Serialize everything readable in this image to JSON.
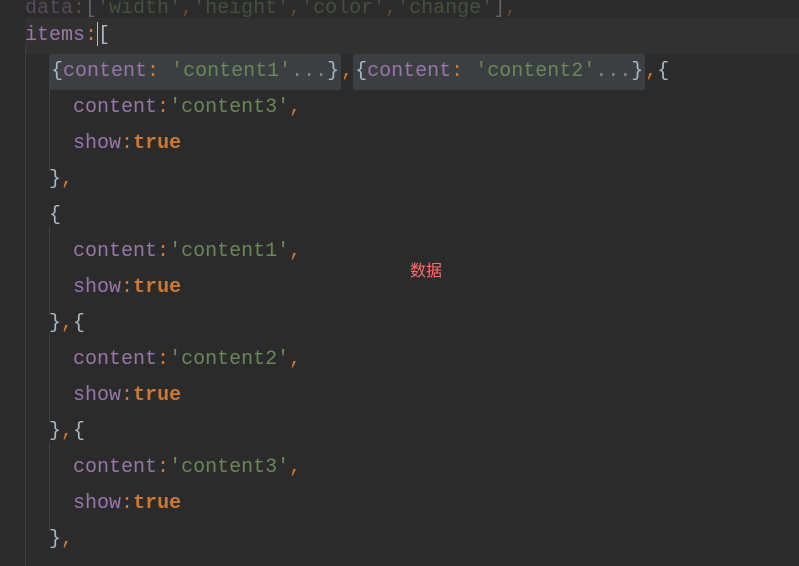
{
  "code": {
    "line0_partial": {
      "text": "data:['width','height','color','change'],"
    },
    "line1": {
      "key": "items",
      "open": "["
    },
    "line2": {
      "collapsed1": {
        "prop": "content",
        "string": "'content1'",
        "dots": "..."
      },
      "collapsed2": {
        "prop": "content",
        "string": "'content2'",
        "dots": "..."
      }
    },
    "obj1": {
      "content_key": "content",
      "content_val": "'content3'",
      "show_key": "show",
      "show_val": "true"
    },
    "obj2": {
      "content_key": "content",
      "content_val": "'content1'",
      "show_key": "show",
      "show_val": "true"
    },
    "obj3": {
      "content_key": "content",
      "content_val": "'content2'",
      "show_key": "show",
      "show_val": "true"
    },
    "obj4": {
      "content_key": "content",
      "content_val": "'content3'",
      "show_key": "show",
      "show_val": "true"
    }
  },
  "annotation": {
    "text": "数据"
  }
}
